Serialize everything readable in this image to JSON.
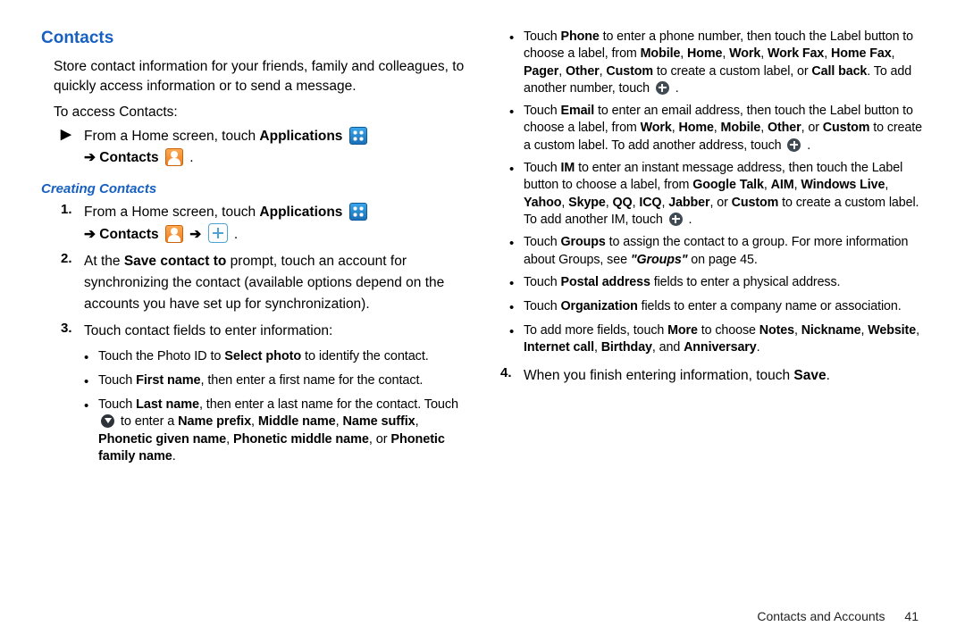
{
  "h1": "Contacts",
  "intro": "Store contact information for your friends, family and colleagues, to quickly access information or to send a message.",
  "access_label": "To access Contacts:",
  "access_step_a": "From a Home screen, touch ",
  "access_step_b": "Applications",
  "arrow": " ➔ ",
  "contacts_word": "Contacts",
  "h2": "Creating Contacts",
  "s1_a": "From a Home screen, touch ",
  "s1_b": "Applications",
  "s2_a": "At the ",
  "s2_b": "Save contact to",
  "s2_c": " prompt, touch an account for synchronizing the contact (available options depend on the accounts you have set up for synchronization).",
  "s3": "Touch contact fields to enter information:",
  "b_photo_a": "Touch the Photo ID to ",
  "b_photo_b": "Select photo",
  "b_photo_c": " to identify the contact.",
  "b_first_a": "Touch ",
  "b_first_b": "First name",
  "b_first_c": ", then enter a first name for the contact.",
  "b_last_a": "Touch ",
  "b_last_b": "Last name",
  "b_last_c": ", then enter a last name for the contact. Touch ",
  "b_last_d": " to enter a ",
  "b_last_e": "Name prefix",
  "b_last_f": "Middle name",
  "b_last_g": "Name suffix",
  "b_last_h": "Phonetic given name",
  "b_last_i": "Phonetic middle name",
  "b_last_j": ", or ",
  "b_last_k": "Phonetic family name",
  "b_last_l": ".",
  "b_phone_a": "Touch ",
  "b_phone_b": "Phone",
  "b_phone_c": " to enter a phone number, then touch the Label button to choose a label, from ",
  "b_phone_d": "Mobile",
  "b_phone_e": "Home",
  "b_phone_f": "Work",
  "b_phone_g": "Work Fax",
  "b_phone_h": "Home Fax",
  "b_phone_i": "Pager",
  "b_phone_j": "Other",
  "b_phone_k": "Custom",
  "b_phone_l": " to create a custom label, or ",
  "b_phone_m": "Call back",
  "b_phone_n": ". To add another number, touch ",
  "b_email_a": "Touch ",
  "b_email_b": "Email",
  "b_email_c": " to enter an email address, then touch the Label button to choose a label, from ",
  "b_email_d": "Work",
  "b_email_e": "Home",
  "b_email_f": "Mobile",
  "b_email_g": "Other",
  "b_email_h": ", or ",
  "b_email_i": "Custom",
  "b_email_j": " to create a custom label. To add another address, touch ",
  "b_im_a": "Touch ",
  "b_im_b": "IM",
  "b_im_c": " to enter an instant message address, then touch the Label button to choose a label, from ",
  "b_im_d": "Google Talk",
  "b_im_e": "AIM",
  "b_im_f": "Windows Live",
  "b_im_g": "Yahoo",
  "b_im_h": "Skype",
  "b_im_i": "QQ",
  "b_im_j": "ICQ",
  "b_im_k": "Jabber",
  "b_im_l": ", or ",
  "b_im_m": "Custom",
  "b_im_n": " to create a custom label. To add another IM, touch ",
  "b_groups_a": "Touch ",
  "b_groups_b": "Groups",
  "b_groups_c": " to assign the contact to a group. For more information about Groups, see ",
  "b_groups_d": "\"Groups\"",
  "b_groups_e": " on page 45.",
  "b_postal_a": "Touch ",
  "b_postal_b": "Postal address",
  "b_postal_c": " fields to enter a physical address.",
  "b_org_a": "Touch ",
  "b_org_b": "Organization",
  "b_org_c": " fields to enter a company name or association.",
  "b_more_a": "To add more fields, touch ",
  "b_more_b": "More",
  "b_more_c": " to choose ",
  "b_more_d": "Notes",
  "b_more_e": "Nickname",
  "b_more_f": "Website",
  "b_more_g": "Internet call",
  "b_more_h": "Birthday",
  "b_more_i": ", and ",
  "b_more_j": "Anniversary",
  "s4_a": "When you finish entering information, touch ",
  "s4_b": "Save",
  "footer_section": "Contacts and Accounts",
  "footer_page": "41",
  "comma": ", ",
  "period": "."
}
